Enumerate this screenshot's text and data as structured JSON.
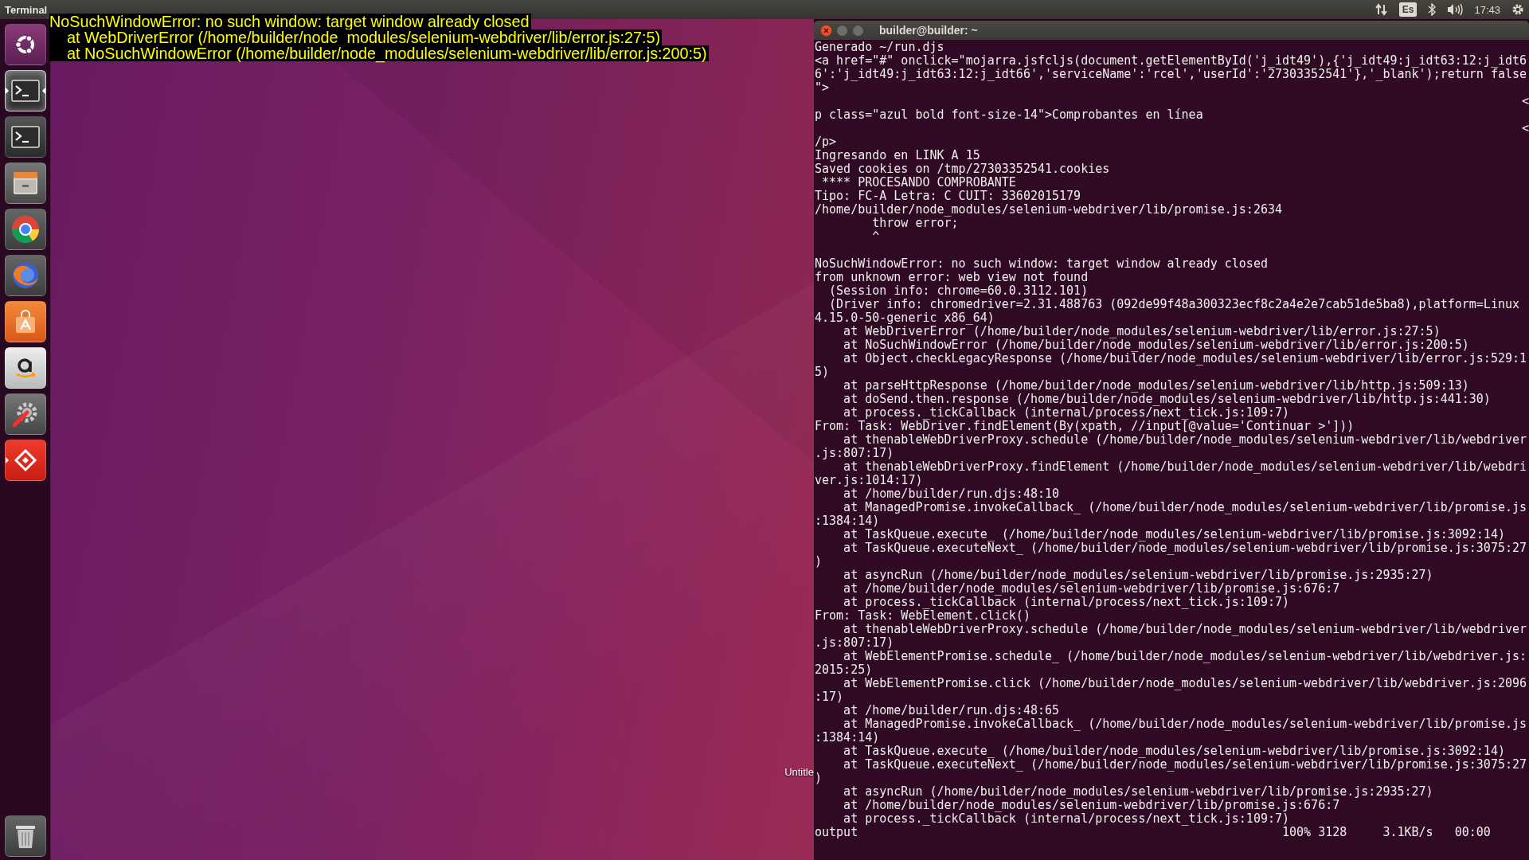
{
  "top_bar": {
    "app_title": "Terminal",
    "language": "Es",
    "time": "17:43"
  },
  "launcher": {
    "items": [
      {
        "kind": "ubuntu",
        "running": false,
        "focused": false
      },
      {
        "kind": "terminal",
        "running": true,
        "focused": true
      },
      {
        "kind": "terminal",
        "running": false,
        "focused": false
      },
      {
        "kind": "files",
        "running": false,
        "focused": false
      },
      {
        "kind": "chrome",
        "running": false,
        "focused": false
      },
      {
        "kind": "firefox",
        "running": false,
        "focused": false
      },
      {
        "kind": "software",
        "running": false,
        "focused": false
      },
      {
        "kind": "amazon",
        "running": false,
        "focused": false
      },
      {
        "kind": "settings",
        "running": false,
        "focused": false
      },
      {
        "kind": "remote",
        "running": true,
        "focused": false
      }
    ],
    "trash": {
      "kind": "trash"
    }
  },
  "notification": {
    "lines": [
      "NoSuchWindowError: no such window: target window already closed",
      "    at WebDriverError (/home/builder/node_modules/selenium-webdriver/lib/error.js:27:5)",
      "    at NoSuchWindowError (/home/builder/node_modules/selenium-webdriver/lib/error.js:200:5)"
    ]
  },
  "desktop": {
    "icon_label": "Untitle"
  },
  "terminal": {
    "title": "builder@builder: ~",
    "lines": [
      {
        "kind": "text",
        "text": "Generado ~/run.djs"
      },
      {
        "kind": "text",
        "text": "<a href=\"#\" onclick=\"mojarra.jsfcljs(document.getElementById('j_idt49'),{'j_idt49:j_idt63:12:j_idt6"
      },
      {
        "kind": "text",
        "text": "6':'j_idt49:j_idt63:12:j_idt66','serviceName':'rcel','userId':'27303352541'},'_blank');return false"
      },
      {
        "kind": "text",
        "text": "\">"
      },
      {
        "kind": "right",
        "text": "<"
      },
      {
        "kind": "text",
        "text": "p class=\"azul bold font-size-14\">Comprobantes en línea"
      },
      {
        "kind": "right",
        "text": "<"
      },
      {
        "kind": "text",
        "text": "/p>"
      },
      {
        "kind": "text",
        "text": "Ingresando en LINK A 15"
      },
      {
        "kind": "text",
        "text": "Saved cookies on /tmp/27303352541.cookies"
      },
      {
        "kind": "text",
        "text": " **** PROCESANDO COMPROBANTE"
      },
      {
        "kind": "text",
        "text": "Tipo: FC-A Letra: C CUIT: 33602015179"
      },
      {
        "kind": "text",
        "text": "/home/builder/node_modules/selenium-webdriver/lib/promise.js:2634"
      },
      {
        "kind": "text",
        "text": "        throw error;"
      },
      {
        "kind": "text",
        "text": "        ^"
      },
      {
        "kind": "blank"
      },
      {
        "kind": "text",
        "text": "NoSuchWindowError: no such window: target window already closed"
      },
      {
        "kind": "text",
        "text": "from unknown error: web view not found"
      },
      {
        "kind": "text",
        "text": "  (Session info: chrome=60.0.3112.101)"
      },
      {
        "kind": "text",
        "text": "  (Driver info: chromedriver=2.31.488763 (092de99f48a300323ecf8c2a4e2e7cab51de5ba8),platform=Linux"
      },
      {
        "kind": "text",
        "text": "4.15.0-50-generic x86_64)"
      },
      {
        "kind": "text",
        "text": "    at WebDriverError (/home/builder/node_modules/selenium-webdriver/lib/error.js:27:5)"
      },
      {
        "kind": "text",
        "text": "    at NoSuchWindowError (/home/builder/node_modules/selenium-webdriver/lib/error.js:200:5)"
      },
      {
        "kind": "text",
        "text": "    at Object.checkLegacyResponse (/home/builder/node_modules/selenium-webdriver/lib/error.js:529:1"
      },
      {
        "kind": "text",
        "text": "5)"
      },
      {
        "kind": "text",
        "text": "    at parseHttpResponse (/home/builder/node_modules/selenium-webdriver/lib/http.js:509:13)"
      },
      {
        "kind": "text",
        "text": "    at doSend.then.response (/home/builder/node_modules/selenium-webdriver/lib/http.js:441:30)"
      },
      {
        "kind": "text",
        "text": "    at process._tickCallback (internal/process/next_tick.js:109:7)"
      },
      {
        "kind": "text",
        "text": "From: Task: WebDriver.findElement(By(xpath, //input[@value='Continuar >']))"
      },
      {
        "kind": "text",
        "text": "    at thenableWebDriverProxy.schedule (/home/builder/node_modules/selenium-webdriver/lib/webdriver"
      },
      {
        "kind": "text",
        "text": ".js:807:17)"
      },
      {
        "kind": "text",
        "text": "    at thenableWebDriverProxy.findElement (/home/builder/node_modules/selenium-webdriver/lib/webdri"
      },
      {
        "kind": "text",
        "text": "ver.js:1014:17)"
      },
      {
        "kind": "text",
        "text": "    at /home/builder/run.djs:48:10"
      },
      {
        "kind": "text",
        "text": "    at ManagedPromise.invokeCallback_ (/home/builder/node_modules/selenium-webdriver/lib/promise.js"
      },
      {
        "kind": "text",
        "text": ":1384:14)"
      },
      {
        "kind": "text",
        "text": "    at TaskQueue.execute_ (/home/builder/node_modules/selenium-webdriver/lib/promise.js:3092:14)"
      },
      {
        "kind": "text",
        "text": "    at TaskQueue.executeNext_ (/home/builder/node_modules/selenium-webdriver/lib/promise.js:3075:27"
      },
      {
        "kind": "text",
        "text": ")"
      },
      {
        "kind": "text",
        "text": "    at asyncRun (/home/builder/node_modules/selenium-webdriver/lib/promise.js:2935:27)"
      },
      {
        "kind": "text",
        "text": "    at /home/builder/node_modules/selenium-webdriver/lib/promise.js:676:7"
      },
      {
        "kind": "text",
        "text": "    at process._tickCallback (internal/process/next_tick.js:109:7)"
      },
      {
        "kind": "text",
        "text": "From: Task: WebElement.click()"
      },
      {
        "kind": "text",
        "text": "    at thenableWebDriverProxy.schedule (/home/builder/node_modules/selenium-webdriver/lib/webdriver"
      },
      {
        "kind": "text",
        "text": ".js:807:17)"
      },
      {
        "kind": "text",
        "text": "    at WebElementPromise.schedule_ (/home/builder/node_modules/selenium-webdriver/lib/webdriver.js:"
      },
      {
        "kind": "text",
        "text": "2015:25)"
      },
      {
        "kind": "text",
        "text": "    at WebElementPromise.click (/home/builder/node_modules/selenium-webdriver/lib/webdriver.js:2096"
      },
      {
        "kind": "text",
        "text": ":17)"
      },
      {
        "kind": "text",
        "text": "    at /home/builder/run.djs:48:65"
      },
      {
        "kind": "text",
        "text": "    at ManagedPromise.invokeCallback_ (/home/builder/node_modules/selenium-webdriver/lib/promise.js"
      },
      {
        "kind": "text",
        "text": ":1384:14)"
      },
      {
        "kind": "text",
        "text": "    at TaskQueue.execute_ (/home/builder/node_modules/selenium-webdriver/lib/promise.js:3092:14)"
      },
      {
        "kind": "text",
        "text": "    at TaskQueue.executeNext_ (/home/builder/node_modules/selenium-webdriver/lib/promise.js:3075:27"
      },
      {
        "kind": "text",
        "text": ")"
      },
      {
        "kind": "text",
        "text": "    at asyncRun (/home/builder/node_modules/selenium-webdriver/lib/promise.js:2935:27)"
      },
      {
        "kind": "text",
        "text": "    at /home/builder/node_modules/selenium-webdriver/lib/promise.js:676:7"
      },
      {
        "kind": "text",
        "text": "    at process._tickCallback (internal/process/next_tick.js:109:7)"
      },
      {
        "kind": "progress",
        "text": "output",
        "stats": "100% 3128     3.1KB/s   00:00"
      }
    ]
  }
}
